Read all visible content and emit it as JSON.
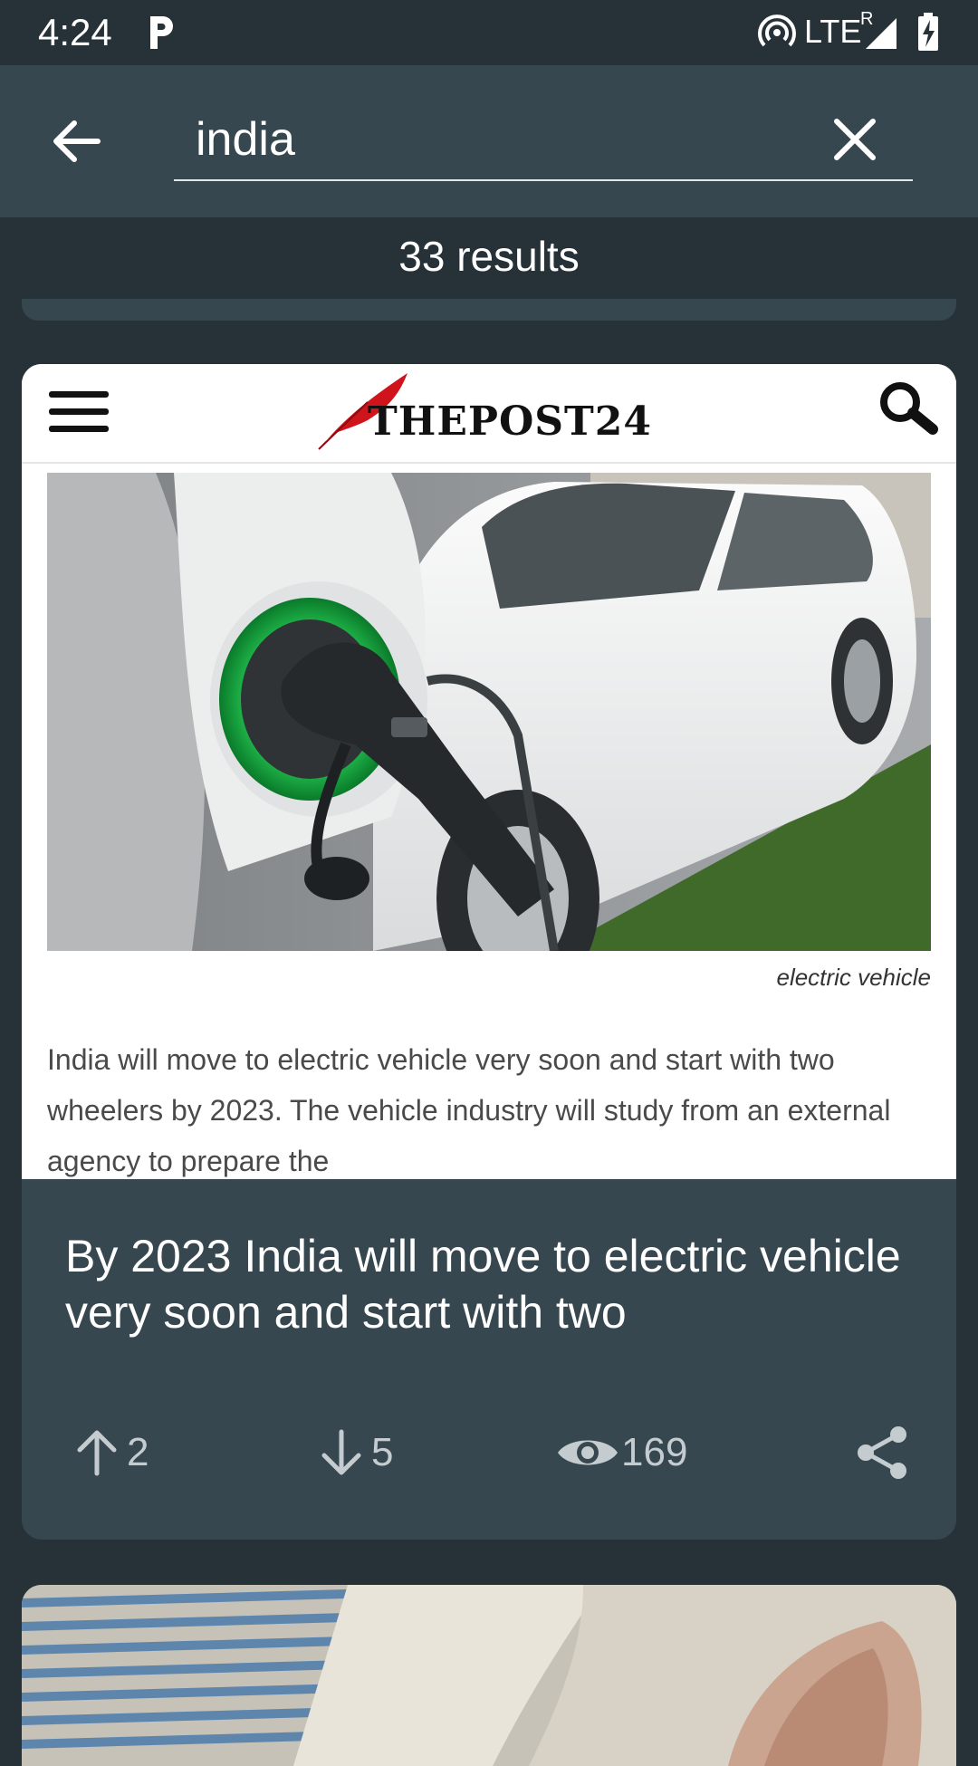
{
  "status_bar": {
    "time": "4:24",
    "network": "LTE",
    "roaming": "R"
  },
  "search": {
    "query": "india",
    "placeholder": ""
  },
  "results": {
    "count_label": "33 results"
  },
  "card": {
    "site_name": "THEPOST24",
    "image_caption": "electric vehicle",
    "excerpt": "India will move to electric vehicle very soon and start with two wheelers by 2023. The vehicle industry will study from an external agency to prepare the",
    "title": "By 2023 India will move to electric vehicle very soon and start with two",
    "upvotes": "2",
    "downvotes": "5",
    "views": "169"
  },
  "colors": {
    "background": "#263238",
    "app_bar": "#37474f",
    "text_primary": "#ffffff",
    "text_secondary": "#c5ccd0",
    "logo_red": "#d0141c",
    "charger_green": "#1ec94a"
  }
}
